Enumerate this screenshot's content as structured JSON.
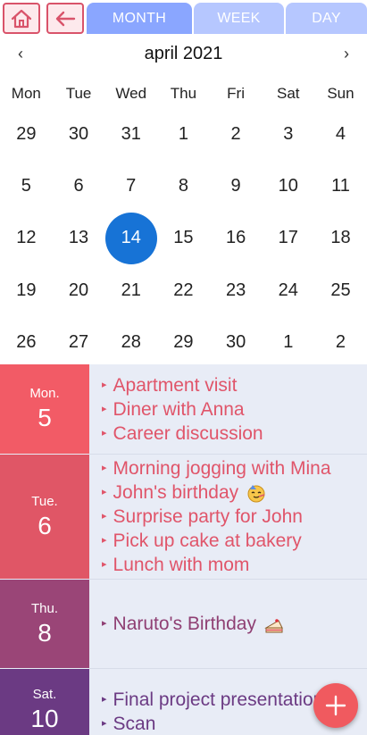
{
  "toolbar": {
    "home_icon": "home-icon",
    "back_icon": "arrow-left-icon",
    "accent": "#d9536a"
  },
  "tabs": [
    {
      "label": "MONTH",
      "active": true
    },
    {
      "label": "WEEK",
      "active": false
    },
    {
      "label": "DAY",
      "active": false
    }
  ],
  "calendar": {
    "title": "april 2021",
    "prev": "‹",
    "next": "›",
    "weekdays": [
      "Mon",
      "Tue",
      "Wed",
      "Thu",
      "Fri",
      "Sat",
      "Sun"
    ],
    "weeks": [
      [
        "29",
        "30",
        "31",
        "1",
        "2",
        "3",
        "4"
      ],
      [
        "5",
        "6",
        "7",
        "8",
        "9",
        "10",
        "11"
      ],
      [
        "12",
        "13",
        "14",
        "15",
        "16",
        "17",
        "18"
      ],
      [
        "19",
        "20",
        "21",
        "22",
        "23",
        "24",
        "25"
      ],
      [
        "26",
        "27",
        "28",
        "29",
        "30",
        "1",
        "2"
      ]
    ],
    "selected_day": "14",
    "selected_color": "#1773d6"
  },
  "agenda": [
    {
      "dow": "Mon.",
      "day": "5",
      "color": "#f25b66",
      "text_color": "#e0556a",
      "events": [
        {
          "text": "Apartment visit"
        },
        {
          "text": "Diner with Anna"
        },
        {
          "text": "Career discussion"
        }
      ]
    },
    {
      "dow": "Tue.",
      "day": "6",
      "color": "#e05666",
      "text_color": "#e0556a",
      "events": [
        {
          "text": "Morning jogging with Mina"
        },
        {
          "text": "John's birthday",
          "emoji": "party-face-icon"
        },
        {
          "text": "Surprise party for John"
        },
        {
          "text": "Pick up cake at bakery"
        },
        {
          "text": "Lunch with mom"
        }
      ]
    },
    {
      "dow": "Thu.",
      "day": "8",
      "color": "#9a4577",
      "text_color": "#8f3f73",
      "events": [
        {
          "text": "Naruto's Birthday",
          "emoji": "cake-icon"
        }
      ]
    },
    {
      "dow": "Sat.",
      "day": "10",
      "color": "#6b3a83",
      "text_color": "#6b3a83",
      "events": [
        {
          "text": "Final project presentation"
        },
        {
          "text": "Scan"
        }
      ]
    }
  ],
  "fab": {
    "icon": "plus-icon",
    "color": "#f05a5f"
  }
}
